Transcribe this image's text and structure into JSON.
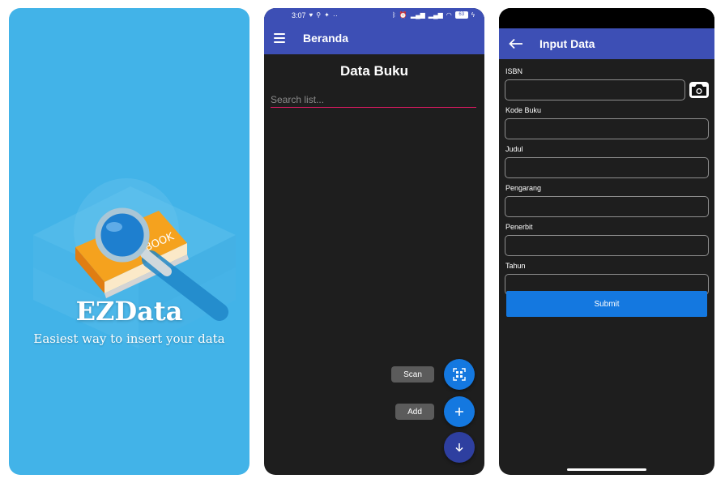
{
  "splash": {
    "brand": "EZData",
    "tagline": "Easiest way to insert your data",
    "art_book_text": "BOOK"
  },
  "beranda": {
    "status": {
      "time": "3:07",
      "dots": "··",
      "battery": "63"
    },
    "appbar_title": "Beranda",
    "heading": "Data Buku",
    "search_placeholder": "Search list...",
    "fab_scan_label": "Scan",
    "fab_add_label": "Add",
    "colors": {
      "appbar": "#3d4fb5",
      "fab_blue": "#1478e0",
      "fab_dark": "#2e3fa0",
      "underline": "#d81b60"
    }
  },
  "input_data": {
    "appbar_title": "Input Data",
    "fields": [
      {
        "label": "ISBN",
        "value": ""
      },
      {
        "label": "Kode Buku",
        "value": ""
      },
      {
        "label": "Judul",
        "value": ""
      },
      {
        "label": "Pengarang",
        "value": ""
      },
      {
        "label": "Penerbit",
        "value": ""
      },
      {
        "label": "Tahun",
        "value": ""
      }
    ],
    "submit_label": "Submit"
  }
}
